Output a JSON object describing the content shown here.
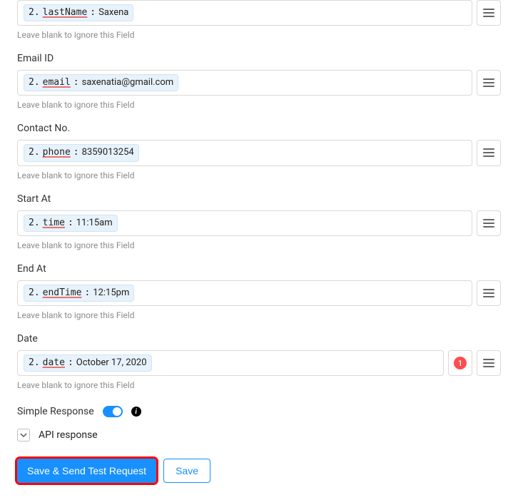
{
  "fields": {
    "lastName": {
      "label": "",
      "idx": "2.",
      "key": "lastName",
      "value": "Saxena",
      "help": "Leave blank to ignore this Field"
    },
    "email": {
      "label": "Email ID",
      "idx": "2.",
      "key": "email",
      "value": "saxenatia@gmail.com",
      "help": "Leave blank to ignore this Field"
    },
    "contact": {
      "label": "Contact No.",
      "idx": "2.",
      "key": "phone",
      "value": "8359013254",
      "help": "Leave blank to ignore this Field"
    },
    "startAt": {
      "label": "Start At",
      "idx": "2.",
      "key": "time",
      "value": "11:15am",
      "help": "Leave blank to ignore this Field"
    },
    "endAt": {
      "label": "End At",
      "idx": "2.",
      "key": "endTime",
      "value": "12:15pm",
      "help": "Leave blank to ignore this Field"
    },
    "date": {
      "label": "Date",
      "idx": "2.",
      "key": "date",
      "value": "October 17, 2020",
      "help": "Leave blank to ignore this Field",
      "badge": "1"
    }
  },
  "simpleResponse": {
    "label": "Simple Response",
    "on": true
  },
  "apiResponse": {
    "label": "API response"
  },
  "buttons": {
    "primary": "Save & Send Test Request",
    "secondary": "Save"
  },
  "tag_colon": ":"
}
